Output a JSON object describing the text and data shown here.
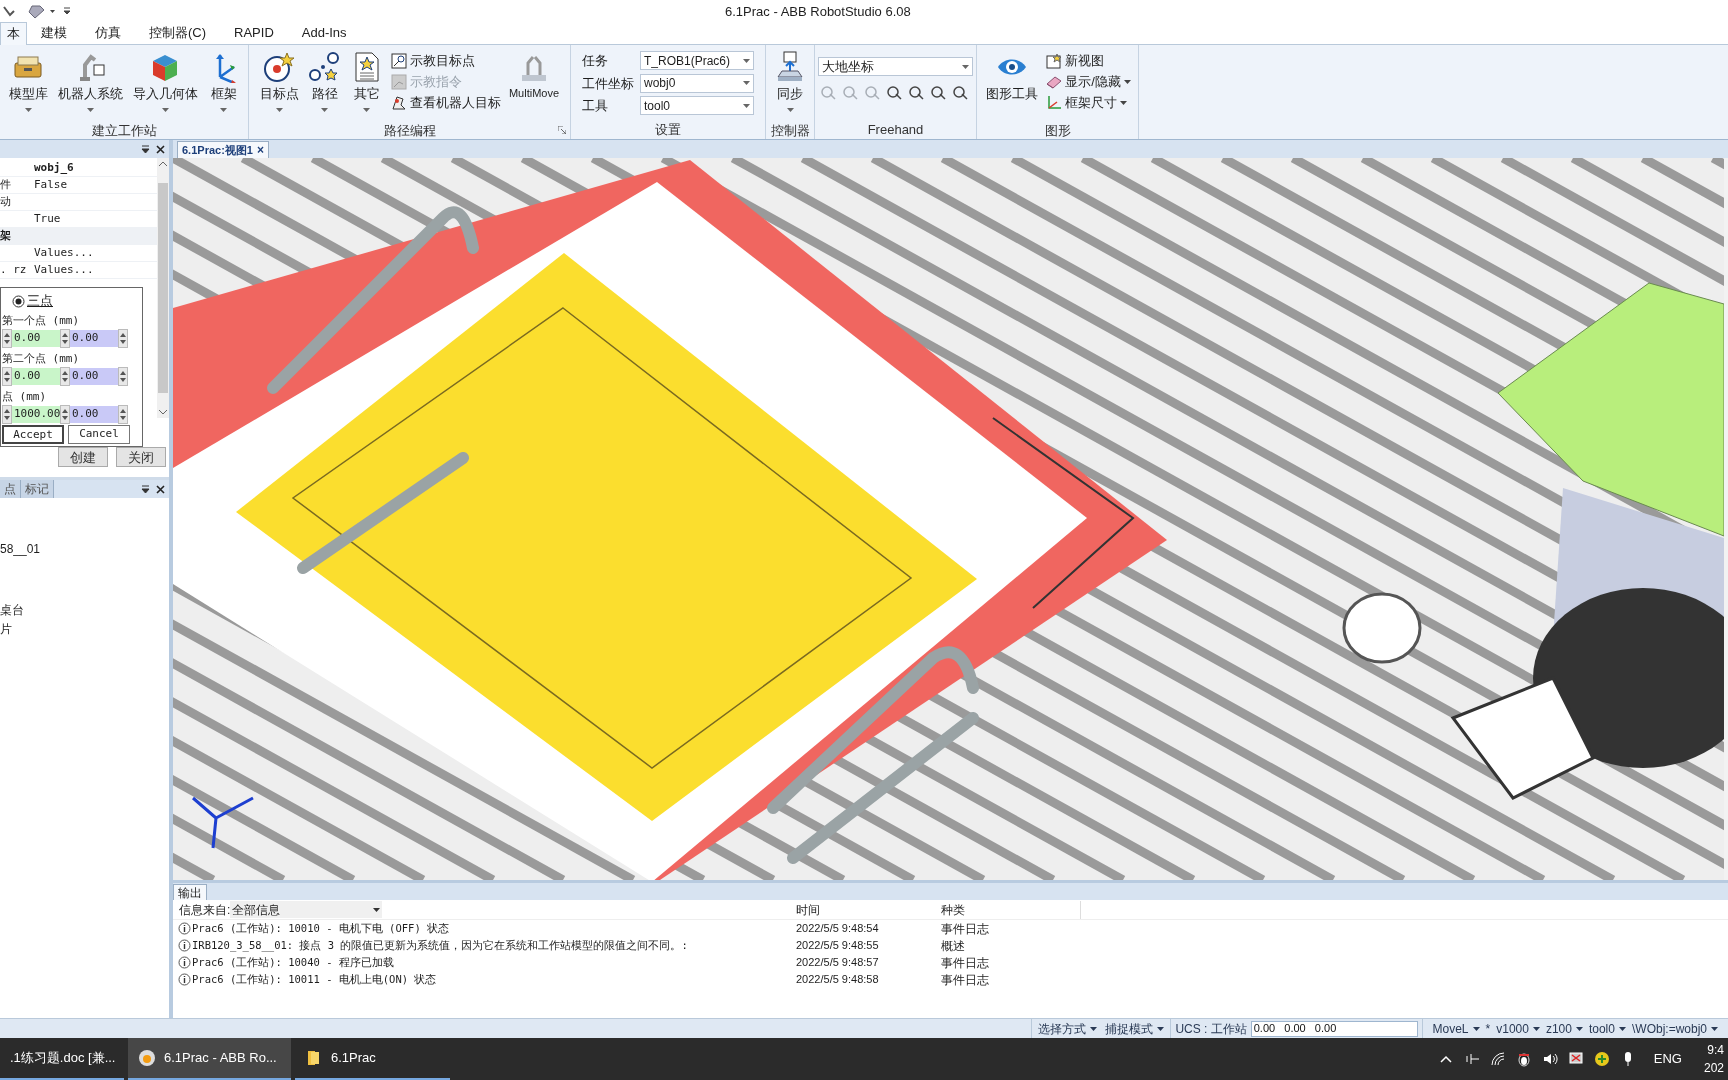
{
  "title_bar": {
    "title": "6.1Prac - ABB RobotStudio 6.08"
  },
  "ribbon_tabs": [
    {
      "label": "本",
      "selected": true
    },
    {
      "label": "建模",
      "selected": false
    },
    {
      "label": "仿真",
      "selected": false
    },
    {
      "label": "控制器(C)",
      "selected": false
    },
    {
      "label": "RAPID",
      "selected": false
    },
    {
      "label": "Add-Ins",
      "selected": false
    }
  ],
  "ribbon_groups": [
    {
      "label": "建立工作站",
      "launcher": false,
      "items": [
        {
          "kind": "large",
          "label": "模型库",
          "dropdown": true
        },
        {
          "kind": "large",
          "label": "机器人系统",
          "dropdown": true
        },
        {
          "kind": "large",
          "label": "导入几何体",
          "dropdown": true
        },
        {
          "kind": "large",
          "label": "框架",
          "dropdown": true
        }
      ]
    },
    {
      "label": "路径编程",
      "launcher": true,
      "items": [
        {
          "kind": "large",
          "label": "目标点",
          "dropdown": true
        },
        {
          "kind": "large",
          "label": "路径",
          "dropdown": true
        },
        {
          "kind": "large",
          "label": "其它",
          "dropdown": true
        },
        {
          "kind": "stack",
          "entries": [
            {
              "label": "示教目标点",
              "disabled": false,
              "dropdown": false
            },
            {
              "label": "示教指令",
              "disabled": true,
              "dropdown": false
            },
            {
              "label": "查看机器人目标",
              "disabled": false,
              "dropdown": false
            }
          ]
        },
        {
          "kind": "large",
          "label": "MultiMove",
          "dropdown": false
        }
      ]
    },
    {
      "label": "设置",
      "launcher": false,
      "items": [
        {
          "kind": "fields",
          "rows": [
            {
              "label": "任务",
              "value": "T_ROB1(Prac6)"
            },
            {
              "label": "工件坐标",
              "value": "wobj0"
            },
            {
              "label": "工具",
              "value": "tool0"
            }
          ]
        }
      ]
    },
    {
      "label": "控制器",
      "launcher": false,
      "items": [
        {
          "kind": "large",
          "label": "同步",
          "dropdown": true
        }
      ]
    },
    {
      "label": "Freehand",
      "launcher": false,
      "items": [
        {
          "kind": "freehand",
          "value": "大地坐标"
        }
      ]
    },
    {
      "label": "图形",
      "launcher": false,
      "items": [
        {
          "kind": "large",
          "label": "图形工具",
          "dropdown": false
        },
        {
          "kind": "stack",
          "entries": [
            {
              "label": "新视图",
              "disabled": false,
              "dropdown": false
            },
            {
              "label": "显示/隐藏",
              "disabled": false,
              "dropdown": true
            },
            {
              "label": "框架尺寸",
              "disabled": false,
              "dropdown": true
            }
          ]
        }
      ]
    }
  ],
  "properties_panel": {
    "rows": [
      {
        "kind": "title",
        "value": "wobj_6"
      },
      {
        "kind": "row",
        "name": "件",
        "value": "False"
      },
      {
        "kind": "row",
        "name": "动"
      },
      {
        "kind": "row",
        "value": "True"
      },
      {
        "kind": "section",
        "name": "架"
      },
      {
        "kind": "row",
        "value": "Values..."
      },
      {
        "kind": "row",
        "name": ". rz",
        "value": "Values..."
      }
    ]
  },
  "frame_dialog": {
    "options": [
      {
        "label": "三点",
        "selected": true
      }
    ],
    "points": [
      {
        "label": "第一个点 (mm)",
        "values": [
          "0.00",
          "0.00"
        ]
      },
      {
        "label": "第二个点 (mm)",
        "values": [
          "0.00",
          "0.00"
        ]
      },
      {
        "label": "点 (mm)",
        "values": [
          "1000.00",
          "0.00"
        ]
      }
    ],
    "buttons": [
      "Accept",
      "Cancel"
    ]
  },
  "panel_buttons": [
    "创建",
    "关闭"
  ],
  "lower_panel": {
    "tabs": [
      {
        "label": "点",
        "selected": false
      },
      {
        "label": "标记",
        "selected": false
      }
    ],
    "items": [
      "58__01",
      "桌台",
      "片"
    ]
  },
  "viewport": {
    "tab": "6.1Prac:视图1",
    "close": "×"
  },
  "output_panel": {
    "tab": "输出",
    "filter_label": "信息来自:",
    "filter_value": "全部信息",
    "columns": [
      "时间",
      "种类"
    ],
    "rows": [
      {
        "message": "Prac6 (工作站): 10010 - 电机下电 (OFF) 状态",
        "time": "2022/5/5 9:48:54",
        "category": "事件日志"
      },
      {
        "message": "IRB120_3_58__01: 接点 3 的限值已更新为系统值，因为它在系统和工作站模型的限值之间不同。:",
        "time": "2022/5/5 9:48:55",
        "category": "概述"
      },
      {
        "message": "Prac6 (工作站): 10040 - 程序已加载",
        "time": "2022/5/5 9:48:57",
        "category": "事件日志"
      },
      {
        "message": "Prac6 (工作站): 10011 - 电机上电(ON) 状态",
        "time": "2022/5/5 9:48:58",
        "category": "事件日志"
      }
    ]
  },
  "status_bar": {
    "modes": [
      {
        "label": "选择方式",
        "dropdown": true
      },
      {
        "label": "捕捉模式",
        "dropdown": true
      }
    ],
    "ucs": "UCS : 工作站",
    "coords": "0.00   0.00   0.00",
    "instruction": [
      {
        "label": "MoveL",
        "dropdown": true
      },
      {
        "label": "*",
        "dropdown": false
      },
      {
        "label": "v1000",
        "dropdown": true
      },
      {
        "label": "z100",
        "dropdown": true
      },
      {
        "label": "tool0",
        "dropdown": true
      },
      {
        "label": "\\WObj:=wobj0",
        "dropdown": true
      }
    ]
  },
  "taskbar": {
    "apps": [
      {
        "label": ".1练习题.doc [兼...",
        "selected": false
      },
      {
        "label": "6.1Prac - ABB Ro...",
        "selected": true
      },
      {
        "label": "6.1Prac",
        "selected": false
      }
    ],
    "language": "ENG",
    "time": "9:4",
    "date": "202"
  }
}
